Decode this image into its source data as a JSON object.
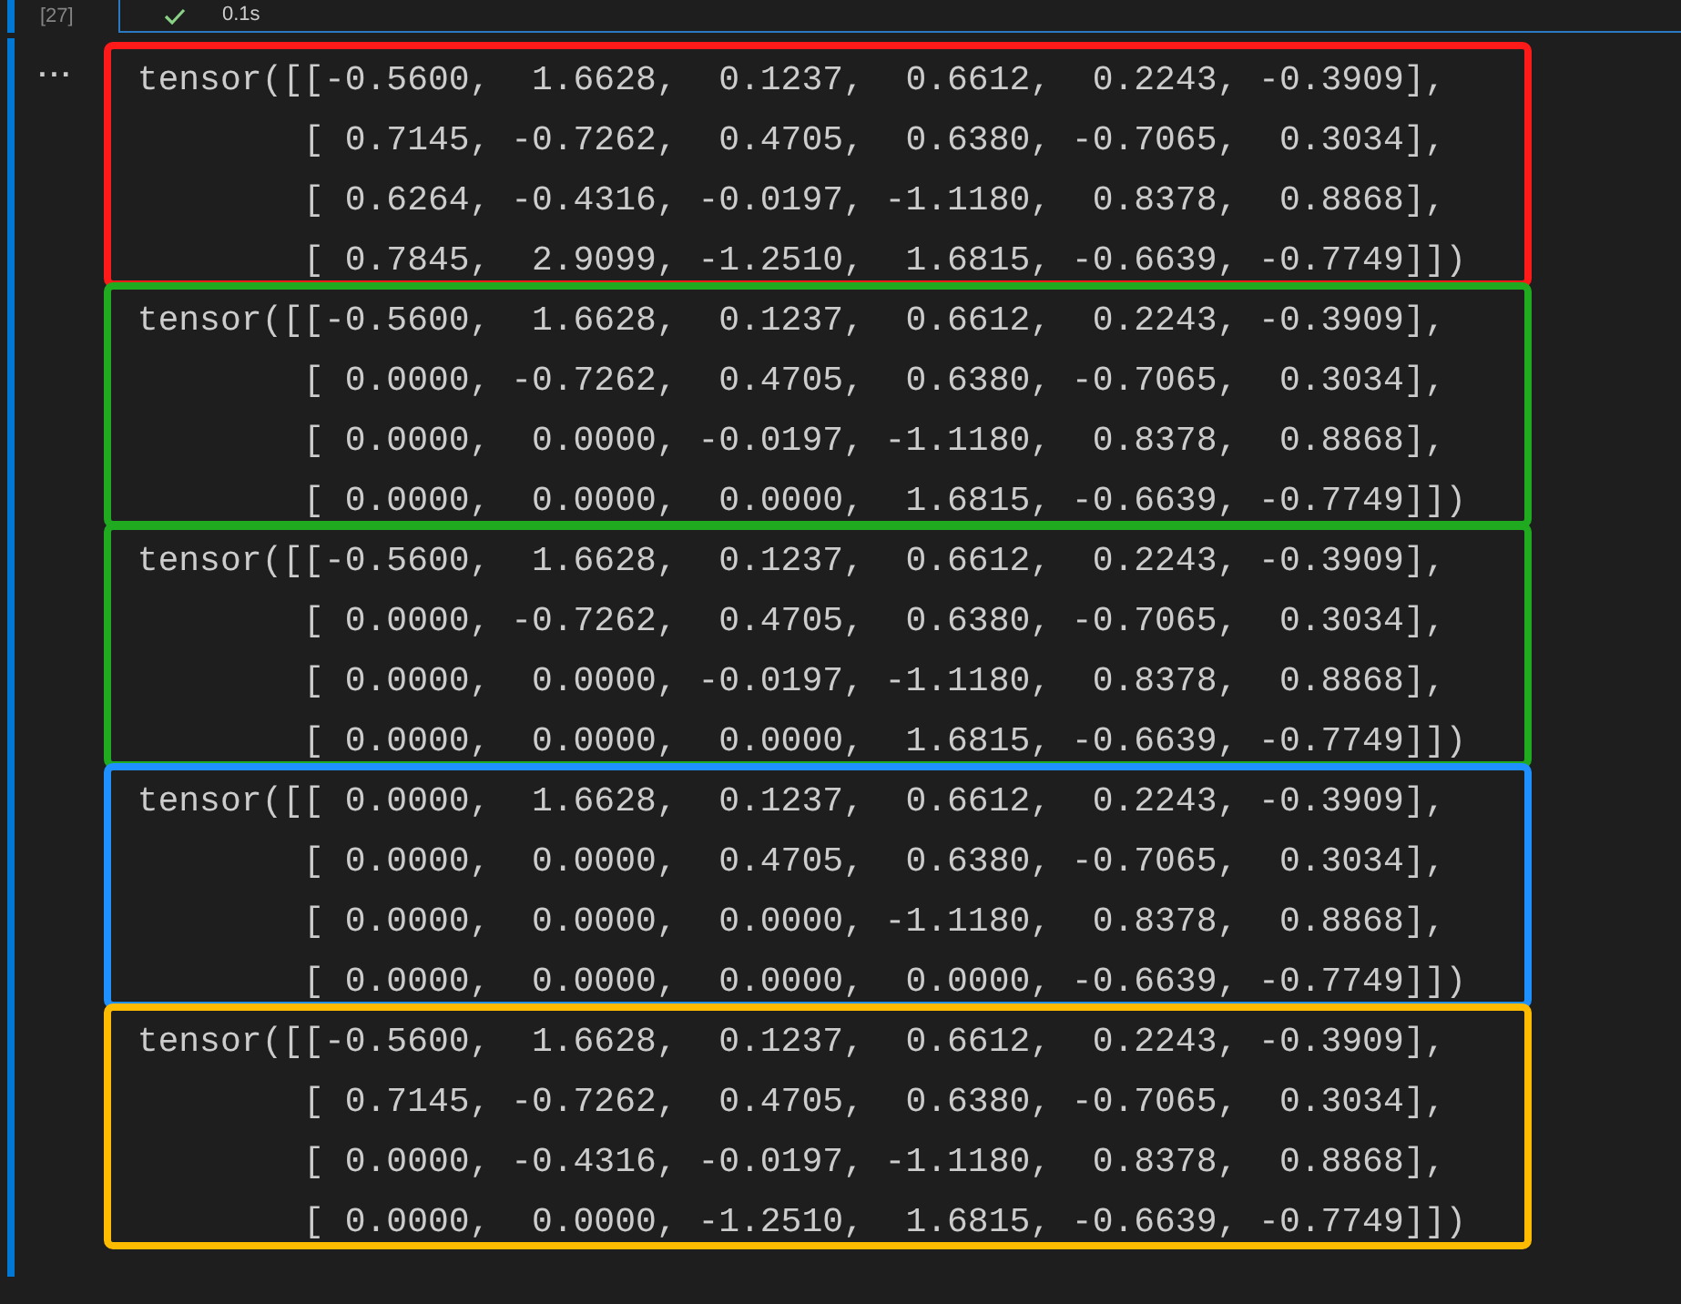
{
  "cell": {
    "execution_count": "[27]",
    "duration": "0.1s",
    "succeeded": true
  },
  "output_menu": "...",
  "outputs": [
    {
      "color": "#ff1a1a",
      "lines": [
        "tensor([[-0.5600,  1.6628,  0.1237,  0.6612,  0.2243, -0.3909],",
        "        [ 0.7145, -0.7262,  0.4705,  0.6380, -0.7065,  0.3034],",
        "        [ 0.6264, -0.4316, -0.0197, -1.1180,  0.8378,  0.8868],",
        "        [ 0.7845,  2.9099, -1.2510,  1.6815, -0.6639, -0.7749]])"
      ]
    },
    {
      "color": "#1faa1f",
      "lines": [
        "tensor([[-0.5600,  1.6628,  0.1237,  0.6612,  0.2243, -0.3909],",
        "        [ 0.0000, -0.7262,  0.4705,  0.6380, -0.7065,  0.3034],",
        "        [ 0.0000,  0.0000, -0.0197, -1.1180,  0.8378,  0.8868],",
        "        [ 0.0000,  0.0000,  0.0000,  1.6815, -0.6639, -0.7749]])"
      ]
    },
    {
      "color": "#1faa1f",
      "lines": [
        "tensor([[-0.5600,  1.6628,  0.1237,  0.6612,  0.2243, -0.3909],",
        "        [ 0.0000, -0.7262,  0.4705,  0.6380, -0.7065,  0.3034],",
        "        [ 0.0000,  0.0000, -0.0197, -1.1180,  0.8378,  0.8868],",
        "        [ 0.0000,  0.0000,  0.0000,  1.6815, -0.6639, -0.7749]])"
      ]
    },
    {
      "color": "#1e90ff",
      "lines": [
        "tensor([[ 0.0000,  1.6628,  0.1237,  0.6612,  0.2243, -0.3909],",
        "        [ 0.0000,  0.0000,  0.4705,  0.6380, -0.7065,  0.3034],",
        "        [ 0.0000,  0.0000,  0.0000, -1.1180,  0.8378,  0.8868],",
        "        [ 0.0000,  0.0000,  0.0000,  0.0000, -0.6639, -0.7749]])"
      ]
    },
    {
      "color": "#ffbb00",
      "lines": [
        "tensor([[-0.5600,  1.6628,  0.1237,  0.6612,  0.2243, -0.3909],",
        "        [ 0.7145, -0.7262,  0.4705,  0.6380, -0.7065,  0.3034],",
        "        [ 0.0000, -0.4316, -0.0197, -1.1180,  0.8378,  0.8868],",
        "        [ 0.0000,  0.0000, -1.2510,  1.6815, -0.6639, -0.7749]])"
      ]
    }
  ]
}
